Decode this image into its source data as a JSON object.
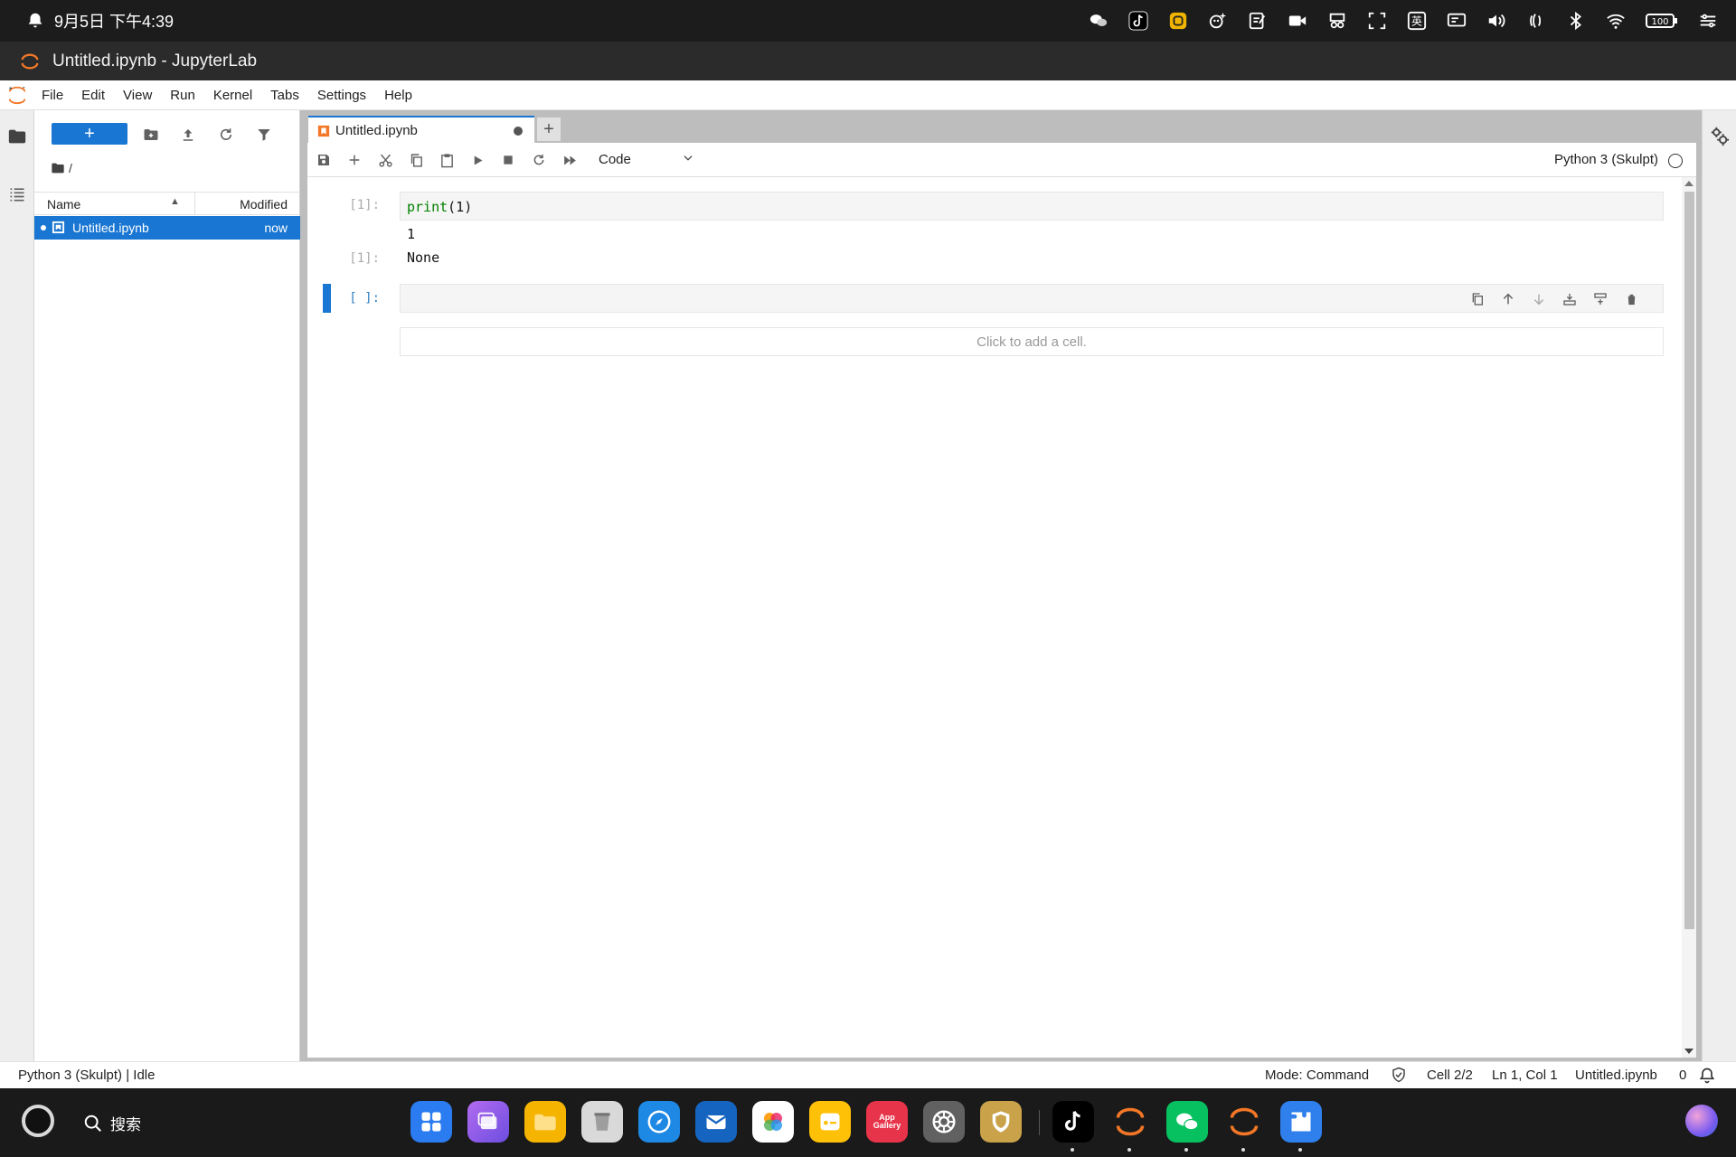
{
  "os_status": {
    "datetime": "9月5日 下午4:39",
    "input_method": "英",
    "battery": "100"
  },
  "window": {
    "title": "Untitled.ipynb - JupyterLab"
  },
  "menu": [
    "File",
    "Edit",
    "View",
    "Run",
    "Kernel",
    "Tabs",
    "Settings",
    "Help"
  ],
  "file_browser": {
    "new_button": "+",
    "breadcrumb": "/",
    "columns": {
      "name": "Name",
      "modified": "Modified"
    },
    "files": [
      {
        "name": "Untitled.ipynb",
        "modified": "now",
        "selected": true,
        "running": true
      }
    ]
  },
  "tabs": [
    {
      "label": "Untitled.ipynb",
      "active": true,
      "unsaved": true
    }
  ],
  "tab_add": "+",
  "notebook_toolbar": {
    "cell_type": "Code",
    "kernel_name": "Python 3 (Skulpt)"
  },
  "cells": [
    {
      "prompt": "[1]:",
      "source_fn": "print",
      "source_rest": "(1)",
      "stdout": "1",
      "result_prompt": "[1]:",
      "result": "None"
    },
    {
      "prompt": "[ ]:",
      "source": ""
    }
  ],
  "add_cell_hint": "Click to add a cell.",
  "status_bar": {
    "kernel_status": "Python 3 (Skulpt) | Idle",
    "mode": "Mode: Command",
    "cell": "Cell 2/2",
    "position": "Ln 1, Col 1",
    "file": "Untitled.ipynb",
    "notifications": "0"
  },
  "dock": {
    "search_label": "搜索",
    "apps": [
      {
        "name": "App Gallery",
        "label": "App\nGallery",
        "color": "#e8344a"
      }
    ]
  },
  "colors": {
    "accent": "#1976d2",
    "jupyter_orange": "#f37726"
  }
}
